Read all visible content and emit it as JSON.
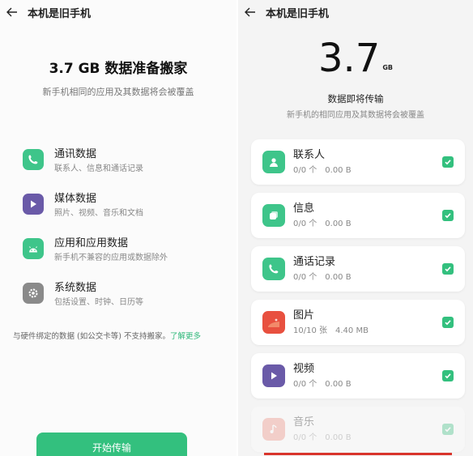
{
  "left": {
    "title": "本机是旧手机",
    "headline": "3.7 GB 数据准备搬家",
    "subtitle": "新手机相同的应用及其数据将会被覆盖",
    "items": [
      {
        "label": "通讯数据",
        "desc": "联系人、信息和通话记录",
        "icon": "phone-icon",
        "color": "#3ec58a"
      },
      {
        "label": "媒体数据",
        "desc": "照片、视频、音乐和文档",
        "icon": "play-icon",
        "color": "#6a5aa8"
      },
      {
        "label": "应用和应用数据",
        "desc": "新手机不兼容的应用或数据除外",
        "icon": "android-icon",
        "color": "#3ec58a"
      },
      {
        "label": "系统数据",
        "desc": "包括设置、时钟、日历等",
        "icon": "gear-icon",
        "color": "#8a8a8a"
      }
    ],
    "notice": "与硬件绑定的数据 (如公交卡等) 不支持搬家。",
    "notice_link": "了解更多",
    "start_button": "开始传输"
  },
  "right": {
    "title": "本机是旧手机",
    "size_value": "3.7",
    "size_unit": "GB",
    "heading": "数据即将传输",
    "subheading": "新手机的相同应用及其数据将会被覆盖",
    "items": [
      {
        "label": "联系人",
        "count": "0/0 个",
        "size": "0.00 B",
        "icon": "contact-icon",
        "color": "#3ec58a",
        "checked": true
      },
      {
        "label": "信息",
        "count": "0/0 个",
        "size": "0.00 B",
        "icon": "message-icon",
        "color": "#3ec58a",
        "checked": true
      },
      {
        "label": "通话记录",
        "count": "0/0 个",
        "size": "0.00 B",
        "icon": "phone-icon",
        "color": "#3ec58a",
        "checked": true
      },
      {
        "label": "图片",
        "count": "10/10 张",
        "size": "4.40 MB",
        "icon": "gallery-icon",
        "color": "#e8503f",
        "checked": true
      },
      {
        "label": "视频",
        "count": "0/0 个",
        "size": "0.00 B",
        "icon": "play-icon",
        "color": "#6a5aa8",
        "checked": true
      },
      {
        "label": "音乐",
        "count": "0/0 个",
        "size": "0.00 B",
        "icon": "music-icon",
        "color": "#f08a7a",
        "checked": true
      }
    ]
  },
  "colors": {
    "accent": "#33c07e",
    "highlight": "#d9342b"
  }
}
